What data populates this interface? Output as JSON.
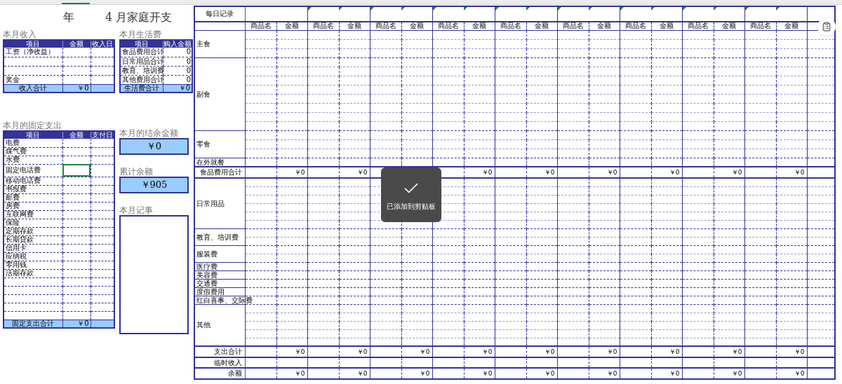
{
  "sheet_title": {
    "year": "年",
    "month_title": "4 月家庭开支"
  },
  "income": {
    "title": "本月收入",
    "columns": [
      "项目",
      "金额",
      "收入日"
    ],
    "rows": [
      {
        "kind": "entry",
        "item": "工资（净收益）"
      },
      {
        "kind": "blank"
      },
      {
        "kind": "blank"
      },
      {
        "kind": "entry",
        "item": "奖金"
      }
    ],
    "total": {
      "label": "收入合计",
      "amount": "￥0"
    }
  },
  "living": {
    "title": "本月生活费",
    "columns": [
      "项目",
      "购入金额"
    ],
    "rows": [
      {
        "item": "食品费用合计",
        "amount": "0"
      },
      {
        "item": "日常用品合计",
        "amount": "0"
      },
      {
        "item": "教育、培训费",
        "amount": "0"
      },
      {
        "item": "其他费用合计",
        "amount": "0"
      }
    ],
    "total": {
      "label": "生活费合计",
      "amount": "￥0"
    }
  },
  "fixed": {
    "title": "本月的固定支出",
    "columns": [
      "项目",
      "金额",
      "支付日"
    ],
    "rows": [
      {
        "kind": "entry",
        "item": "电费",
        "selected": false
      },
      {
        "kind": "entry",
        "item": "煤气费",
        "selected": false
      },
      {
        "kind": "entry",
        "item": "水费",
        "selected": false
      },
      {
        "kind": "entry",
        "item": "固定电话费",
        "selected": true
      },
      {
        "kind": "entry",
        "item": "移动电话费",
        "selected": false
      },
      {
        "kind": "entry",
        "item": "书报费",
        "selected": false
      },
      {
        "kind": "entry",
        "item": "邮费",
        "selected": false
      },
      {
        "kind": "entry",
        "item": "房费",
        "selected": false
      },
      {
        "kind": "entry",
        "item": "互联网费",
        "selected": false
      },
      {
        "kind": "entry",
        "item": "保险",
        "selected": false
      },
      {
        "kind": "entry",
        "item": "定期存款",
        "selected": false
      },
      {
        "kind": "entry",
        "item": "长期贷款",
        "selected": false
      },
      {
        "kind": "entry",
        "item": "信用卡",
        "selected": false
      },
      {
        "kind": "entry",
        "item": "应纳税",
        "selected": false
      },
      {
        "kind": "entry",
        "item": "零用钱",
        "selected": false
      },
      {
        "kind": "entry",
        "item": "活期存款",
        "selected": false
      },
      {
        "kind": "blank",
        "selected": false
      },
      {
        "kind": "blank",
        "selected": false
      },
      {
        "kind": "blank",
        "selected": false
      },
      {
        "kind": "blank",
        "selected": false
      },
      {
        "kind": "blank",
        "selected": false
      }
    ],
    "total": {
      "label": "固定支出合计",
      "amount": "￥0"
    }
  },
  "balance": {
    "label": "本月的结余金额",
    "value": "￥0"
  },
  "cumulative": {
    "label": "累计余额",
    "value": "￥905"
  },
  "notes": {
    "label": "本月记事"
  },
  "daily": {
    "title": "每日记录",
    "pairs": [
      {
        "name": "商品名",
        "amount": "金额",
        "comment": false
      },
      {
        "name": "商品名",
        "amount": "金额",
        "comment": true
      },
      {
        "name": "商品名",
        "amount": "金额",
        "comment": true
      },
      {
        "name": "商品名",
        "amount": "金额",
        "comment": true
      },
      {
        "name": "商品名",
        "amount": "金额",
        "comment": true
      },
      {
        "name": "商品名",
        "amount": "金额",
        "comment": true
      },
      {
        "name": "商品名",
        "amount": "金额",
        "comment": true
      },
      {
        "name": "商品名",
        "amount": "金额",
        "comment": true
      },
      {
        "name": "商品名",
        "amount": "金额",
        "comment": true
      }
    ],
    "rows": [
      {
        "kind": "category",
        "label": "主食"
      },
      {
        "kind": "category",
        "label": "副食"
      },
      {
        "kind": "category",
        "label": "零食"
      },
      {
        "kind": "category",
        "label": "在外就餐"
      },
      {
        "kind": "total",
        "label": "食品费用合计",
        "values": [
          {
            "kind": "amount",
            "text": "￥0"
          },
          {
            "kind": "amount",
            "text": "￥0"
          },
          {
            "kind": "covered"
          },
          {
            "kind": "amount",
            "text": "￥0"
          },
          {
            "kind": "amount",
            "text": "￥0"
          },
          {
            "kind": "amount",
            "text": "￥0"
          },
          {
            "kind": "amount",
            "text": "￥0"
          },
          {
            "kind": "amount",
            "text": "￥0"
          },
          {
            "kind": "amount",
            "text": "￥0"
          }
        ]
      },
      {
        "kind": "category",
        "label": "日常用品"
      },
      {
        "kind": "category",
        "label": "教育、培训费"
      },
      {
        "kind": "category",
        "label": "服装费"
      },
      {
        "kind": "category",
        "label": "医疗费"
      },
      {
        "kind": "category",
        "label": "美容费"
      },
      {
        "kind": "category",
        "label": "交通费"
      },
      {
        "kind": "category",
        "label": "度假费用"
      },
      {
        "kind": "category",
        "label": "红白喜事、交际费"
      },
      {
        "kind": "category",
        "label": "其他"
      },
      {
        "kind": "total",
        "label": "支出合计",
        "values": [
          {
            "kind": "amount",
            "text": "￥0"
          },
          {
            "kind": "amount",
            "text": "￥0"
          },
          {
            "kind": "amount",
            "text": "￥0"
          },
          {
            "kind": "amount",
            "text": "￥0"
          },
          {
            "kind": "amount",
            "text": "￥0"
          },
          {
            "kind": "amount",
            "text": "￥0"
          },
          {
            "kind": "amount",
            "text": "￥0"
          },
          {
            "kind": "amount",
            "text": "￥0"
          },
          {
            "kind": "amount",
            "text": "￥0"
          }
        ]
      },
      {
        "kind": "total",
        "label": "临时收入"
      },
      {
        "kind": "total",
        "label": "余额",
        "values": [
          {
            "kind": "amount",
            "text": "￥0"
          },
          {
            "kind": "amount",
            "text": "￥0"
          },
          {
            "kind": "amount",
            "text": "￥0"
          },
          {
            "kind": "amount",
            "text": "￥0"
          },
          {
            "kind": "amount",
            "text": "￥0"
          },
          {
            "kind": "amount",
            "text": "￥0"
          },
          {
            "kind": "amount",
            "text": "￥0"
          },
          {
            "kind": "amount",
            "text": "￥0"
          },
          {
            "kind": "amount",
            "text": "￥0"
          }
        ]
      }
    ]
  },
  "toast": {
    "message": "已添加到剪贴板"
  }
}
